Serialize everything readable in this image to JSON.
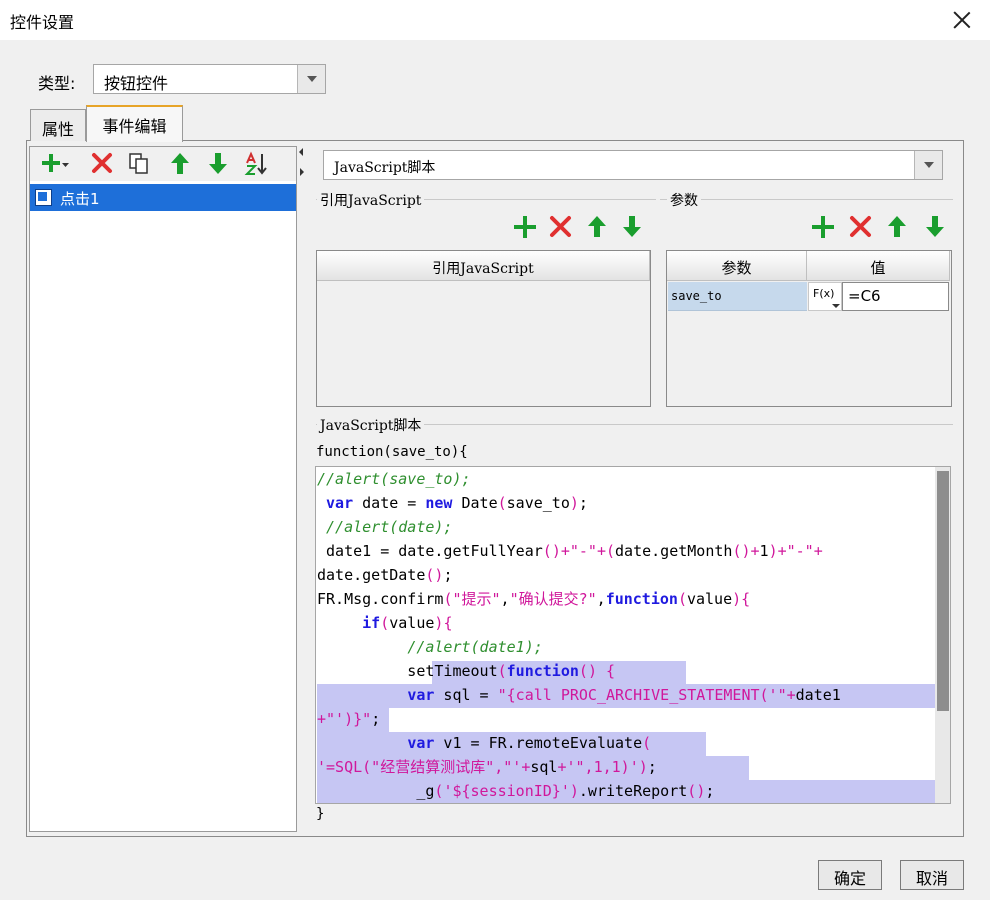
{
  "window": {
    "title": "控件设置"
  },
  "type_row": {
    "label": "类型:",
    "selected": "按钮控件"
  },
  "tabs": [
    {
      "label": "属性"
    },
    {
      "label": "事件编辑"
    }
  ],
  "left_toolbar": {
    "icons": [
      "add-icon",
      "delete-icon",
      "copy-icon",
      "move-up-icon",
      "move-down-icon",
      "sort-icon"
    ],
    "colors": {
      "green": "#1a9e2e",
      "red": "#e03030"
    }
  },
  "events": [
    {
      "label": "点击1"
    }
  ],
  "script_type": {
    "selected": "JavaScript脚本"
  },
  "ref_js": {
    "group_title": "引用JavaScript",
    "column_header": "引用JavaScript"
  },
  "params": {
    "group_title": "参数",
    "headers": {
      "name": "参数",
      "value": "值"
    },
    "rows": [
      {
        "name": "save_to",
        "fx_label": "F(x)",
        "value": "=C6"
      }
    ]
  },
  "script": {
    "group_title": "JavaScript脚本",
    "header": "function(save_to){",
    "footer": "}",
    "lines": [
      "//alert(save_to);",
      " var date = new Date(save_to);",
      " //alert(date);",
      " date1 = date.getFullYear()+\"-\"+(date.getMonth()+1)+\"-\"+",
      "date.getDate();",
      "FR.Msg.confirm(\"提示\",\"确认提交?\",function(value){",
      "     if(value){",
      "          //alert(date1);",
      "          setTimeout(function() {",
      "          var sql = \"{call PROC_ARCHIVE_STATEMENT('\"+date1",
      "+\"')}\";",
      "          var v1 = FR.remoteEvaluate(",
      "'=SQL(\"经营结算测试库\",\"'+sql+'\",1,1)');",
      "           _g('${sessionID}').writeReport();"
    ]
  },
  "buttons": {
    "ok": "确定",
    "cancel": "取消"
  }
}
